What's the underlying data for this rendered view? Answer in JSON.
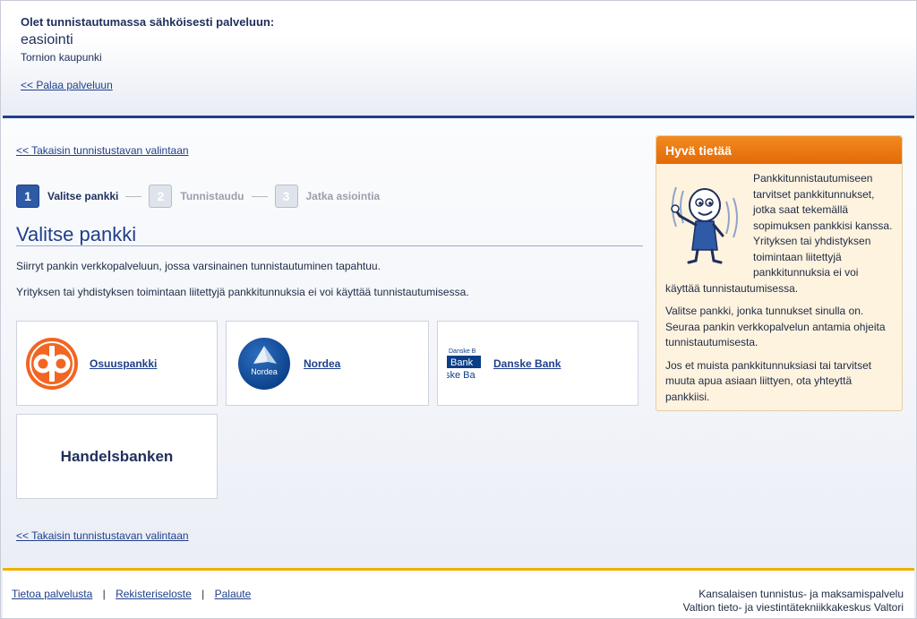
{
  "header": {
    "intro": "Olet tunnistautumassa sähköisesti palveluun:",
    "service": "easiointi",
    "organization": "Tornion kaupunki",
    "back_link": "<< Palaa palveluun"
  },
  "main": {
    "back_link_top": "<< Takaisin tunnistustavan valintaan",
    "back_link_bottom": "<< Takaisin tunnistustavan valintaan",
    "steps": [
      {
        "num": "1",
        "label": "Valitse pankki"
      },
      {
        "num": "2",
        "label": "Tunnistaudu"
      },
      {
        "num": "3",
        "label": "Jatka asiointia"
      }
    ],
    "title": "Valitse pankki",
    "paragraph1": "Siirryt pankin verkkopalveluun, jossa varsinainen tunnistautuminen tapahtuu.",
    "paragraph2": "Yrityksen tai yhdistyksen toimintaan liitettyjä pankkitunnuksia ei voi käyttää tunnistautumisessa.",
    "banks": [
      {
        "label": "Osuuspankki",
        "icon": "op-logo-icon"
      },
      {
        "label": "Nordea",
        "icon": "nordea-logo-icon",
        "logo_text": "Nordea"
      },
      {
        "label": "Danske Bank",
        "icon": "danske-logo-icon"
      },
      {
        "label": "Handelsbanken"
      }
    ],
    "danske_logo_lines": [
      "Danske B",
      "Bank",
      "ske Ba"
    ]
  },
  "info": {
    "title": "Hyvä tietää",
    "p1": "Pankkitunnistautumiseen tarvitset pankkitunnukset, jotka saat tekemällä sopimuksen pankkisi kanssa. Yrityksen tai yhdistyksen toimintaan liitettyjä pankkitunnuksia ei voi käyttää tunnistautumisessa.",
    "p2": "Valitse pankki, jonka tunnukset sinulla on. Seuraa pankin verkkopalvelun antamia ohjeita tunnistautumisesta.",
    "p3": "Jos et muista pankkitunnuksiasi tai tarvitset muuta apua asiaan liittyen, ota yhteyttä pankkiisi."
  },
  "footer": {
    "links": [
      "Tietoa palvelusta",
      "Rekisteriseloste",
      "Palaute"
    ],
    "separator": "|",
    "right_line1": "Kansalaisen tunnistus- ja maksamispalvelu",
    "right_line2": "Valtion tieto- ja viestintätekniikkakeskus Valtori"
  },
  "colors": {
    "brand_blue": "#1f3f8a",
    "info_orange": "#e36a08",
    "footer_yellow": "#f0b000",
    "op_orange": "#f26522",
    "nordea_blue": "#0a3e86"
  }
}
